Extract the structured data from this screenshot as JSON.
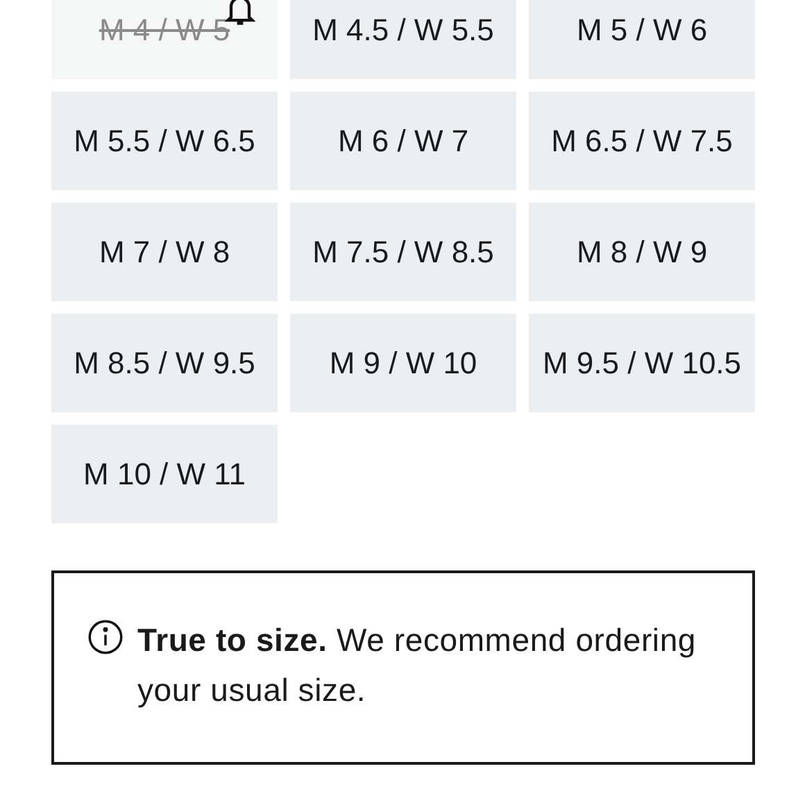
{
  "sizes": [
    {
      "label": "M 4 / W 5",
      "available": false
    },
    {
      "label": "M 4.5 / W 5.5",
      "available": true
    },
    {
      "label": "M 5 / W 6",
      "available": true
    },
    {
      "label": "M 5.5 / W 6.5",
      "available": true
    },
    {
      "label": "M 6 / W 7",
      "available": true
    },
    {
      "label": "M 6.5 / W 7.5",
      "available": true
    },
    {
      "label": "M 7 / W 8",
      "available": true
    },
    {
      "label": "M 7.5 / W 8.5",
      "available": true
    },
    {
      "label": "M 8 / W 9",
      "available": true
    },
    {
      "label": "M 8.5 / W 9.5",
      "available": true
    },
    {
      "label": "M 9 / W 10",
      "available": true
    },
    {
      "label": "M 9.5 / W 10.5",
      "available": true
    },
    {
      "label": "M 10 / W 11",
      "available": true
    }
  ],
  "fit_note": {
    "text": "**True to size.** We recommend ordering your usual size."
  }
}
